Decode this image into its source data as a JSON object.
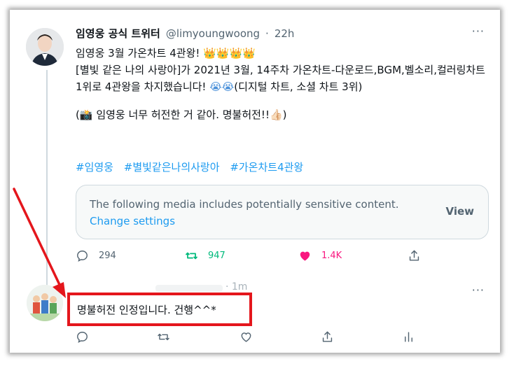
{
  "tweet": {
    "author_name": "임영웅 공식 트위터",
    "handle": "@limyoungwoong",
    "separator": "·",
    "time": "22h",
    "more_label": "···",
    "line1": "임영웅 3월 가온차트 4관왕!",
    "crowns": "👑👑👑👑",
    "line2": "[별빛 같은 나의 사랑아]가 2021년 3월, 14주차 가온차트-다운로드,BGM,벨소리,컬러링차트 1위로 4관왕을 차지했습니다!",
    "cry_emojis": "😭😭",
    "line2_suffix": "(디지털 차트,  소셜 차트 3위)",
    "line3_prefix": "(",
    "camera_emoji": "📸",
    "line3": " 임영웅 너무 허전한 거 같아. 명불허전!!",
    "thumb_emoji": "👍🏻",
    "line3_suffix": ")",
    "hashtags": [
      "#임영웅",
      "#별빛같은나의사랑아",
      "#가온차트4관왕"
    ],
    "media_notice": "The following media includes potentially sensitive content.",
    "media_change": "Change settings",
    "media_view": "View",
    "replies": "294",
    "retweets": "947",
    "likes": "1.4K"
  },
  "reply": {
    "time": "· 1m",
    "more_label": "···",
    "text": "명불허전 인정입니다. 건행^^*"
  },
  "colors": {
    "accent": "#1d9bf0",
    "retweet": "#00ba7c",
    "like": "#f91880",
    "annotation": "#e4161c"
  }
}
